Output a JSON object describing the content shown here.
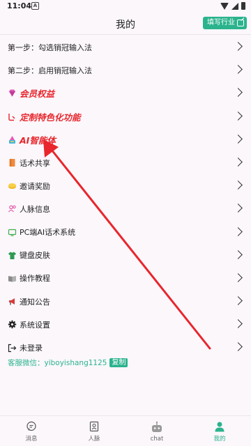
{
  "status": {
    "time": "11:04",
    "app_icon": "A"
  },
  "header": {
    "title": "我的",
    "industry_button": "填写行业"
  },
  "menu": [
    {
      "label": "第一步：勾选销冠输入法",
      "style": "normal",
      "icon": ""
    },
    {
      "label": "第二步：启用销冠输入法",
      "style": "normal",
      "icon": ""
    },
    {
      "label": "会员权益",
      "style": "red",
      "icon": "diamond-icon"
    },
    {
      "label": "定制特色化功能",
      "style": "red",
      "icon": "custom-icon"
    },
    {
      "label": "AI智能体",
      "style": "red",
      "icon": "ai-agent-icon"
    },
    {
      "label": "话术共享",
      "style": "normal",
      "icon": "share-book-icon"
    },
    {
      "label": "邀请奖励",
      "style": "normal",
      "icon": "coins-icon"
    },
    {
      "label": "人脉信息",
      "style": "normal",
      "icon": "contacts-icon"
    },
    {
      "label": "PC端AI话术系统",
      "style": "normal",
      "icon": "monitor-icon"
    },
    {
      "label": "键盘皮肤",
      "style": "normal",
      "icon": "shirt-icon"
    },
    {
      "label": "操作教程",
      "style": "normal",
      "icon": "book-icon"
    },
    {
      "label": "通知公告",
      "style": "normal",
      "icon": "megaphone-icon"
    },
    {
      "label": "系统设置",
      "style": "normal",
      "icon": "gear-icon"
    },
    {
      "label": "未登录",
      "style": "normal",
      "icon": "login-icon"
    }
  ],
  "service": {
    "label": "客服微信：yiboyishang1125",
    "copy": "复制"
  },
  "tabs": [
    {
      "label": "消息",
      "icon": "message-icon",
      "active": false
    },
    {
      "label": "人脉",
      "icon": "contacts-card-icon",
      "active": false
    },
    {
      "label": "chat",
      "icon": "robot-icon",
      "active": false
    },
    {
      "label": "我的",
      "icon": "profile-icon",
      "active": true
    }
  ],
  "colors": {
    "accent": "#2bb38e",
    "highlight_red": "#e8262c",
    "background": "#fbf7fb"
  }
}
